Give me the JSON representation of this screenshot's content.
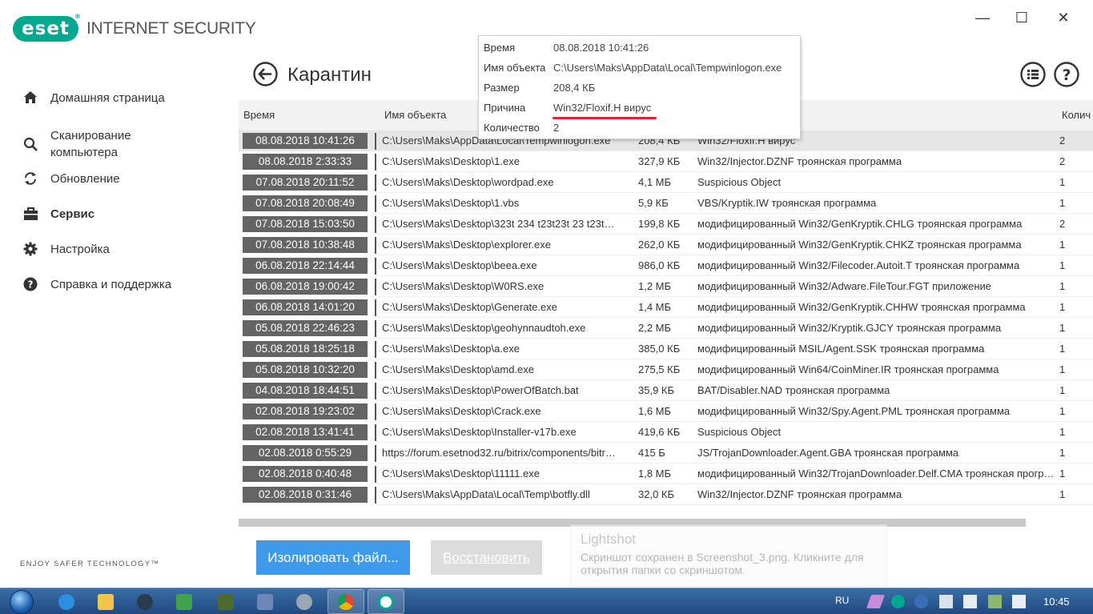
{
  "app": {
    "logo": "eset",
    "product": "INTERNET SECURITY",
    "tagline": "ENJOY SAFER TECHNOLOGY™",
    "colors": {
      "brand": "#00a88f",
      "accent": "#3d9be9",
      "time_cell": "#646464",
      "highlight": "#e0262a"
    }
  },
  "window_controls": {
    "minimize": "—",
    "maximize": "☐",
    "close": "✕"
  },
  "sidebar": {
    "items": [
      {
        "label": "Домашняя страница",
        "icon": "home-icon"
      },
      {
        "label": "Сканирование\nкомпьютера",
        "icon": "search-icon"
      },
      {
        "label": "Обновление",
        "icon": "refresh-icon"
      },
      {
        "label": "Сервис",
        "icon": "briefcase-icon",
        "active": true
      },
      {
        "label": "Настройка",
        "icon": "gear-icon"
      },
      {
        "label": "Справка и поддержка",
        "icon": "question-icon"
      }
    ]
  },
  "page": {
    "title": "Карантин"
  },
  "table": {
    "columns": {
      "time": "Время",
      "name": "Имя объекта",
      "count": "Колич"
    },
    "rows": [
      {
        "time": "08.08.2018 10:41:26",
        "name": "C:\\Users\\Maks\\AppData\\Local\\Tempwinlogon.exe",
        "size": "208,4 КБ",
        "reason": "Win32/Floxif.H вирус",
        "count": "2"
      },
      {
        "time": "08.08.2018 2:33:33",
        "name": "C:\\Users\\Maks\\Desktop\\1.exe",
        "size": "327,9 КБ",
        "reason": "Win32/Injector.DZNF троянская программа",
        "count": "2"
      },
      {
        "time": "07.08.2018 20:11:52",
        "name": "C:\\Users\\Maks\\Desktop\\wordpad.exe",
        "size": "4,1 МБ",
        "reason": "Suspicious Object",
        "count": "1"
      },
      {
        "time": "07.08.2018 20:08:49",
        "name": "C:\\Users\\Maks\\Desktop\\1.vbs",
        "size": "5,9 КБ",
        "reason": "VBS/Kryptik.IW троянская программа",
        "count": "1"
      },
      {
        "time": "07.08.2018 15:03:50",
        "name": "C:\\Users\\Maks\\Desktop\\323t 234 t23t23t 23 t23t…",
        "size": "199,8 КБ",
        "reason": "модифицированный Win32/GenKryptik.CHLG троянская программа",
        "count": "2"
      },
      {
        "time": "07.08.2018 10:38:48",
        "name": "C:\\Users\\Maks\\Desktop\\explorer.exe",
        "size": "262,0 КБ",
        "reason": "модифицированный Win32/GenKryptik.CHKZ троянская программа",
        "count": "1"
      },
      {
        "time": "06.08.2018 22:14:44",
        "name": "C:\\Users\\Maks\\Desktop\\beea.exe",
        "size": "986,0 КБ",
        "reason": "модифицированный Win32/Filecoder.Autoit.T троянская программа",
        "count": "1"
      },
      {
        "time": "06.08.2018 19:00:42",
        "name": "C:\\Users\\Maks\\Desktop\\W0RS.exe",
        "size": "1,2 МБ",
        "reason": "модифицированный Win32/Adware.FileTour.FGT приложение",
        "count": "1"
      },
      {
        "time": "06.08.2018 14:01:20",
        "name": "C:\\Users\\Maks\\Desktop\\Generate.exe",
        "size": "1,4 МБ",
        "reason": "модифицированный Win32/GenKryptik.CHHW троянская программа",
        "count": "1"
      },
      {
        "time": "05.08.2018 22:46:23",
        "name": "C:\\Users\\Maks\\Desktop\\geohynnaudtoh.exe",
        "size": "2,2 МБ",
        "reason": "модифицированный Win32/Kryptik.GJCY троянская программа",
        "count": "1"
      },
      {
        "time": "05.08.2018 18:25:18",
        "name": "C:\\Users\\Maks\\Desktop\\a.exe",
        "size": "385,0 КБ",
        "reason": "модифицированный MSIL/Agent.SSK троянская программа",
        "count": "1"
      },
      {
        "time": "05.08.2018 10:32:20",
        "name": "C:\\Users\\Maks\\Desktop\\amd.exe",
        "size": "275,5 КБ",
        "reason": "модифицированный Win64/CoinMiner.IR троянская программа",
        "count": "1"
      },
      {
        "time": "04.08.2018 18:44:51",
        "name": "C:\\Users\\Maks\\Desktop\\PowerOfBatch.bat",
        "size": "35,9 КБ",
        "reason": "BAT/Disabler.NAD троянская программа",
        "count": "1"
      },
      {
        "time": "02.08.2018 19:23:02",
        "name": "C:\\Users\\Maks\\Desktop\\Crack.exe",
        "size": "1,6 МБ",
        "reason": "модифицированный Win32/Spy.Agent.PML троянская программа",
        "count": "1"
      },
      {
        "time": "02.08.2018 13:41:41",
        "name": "C:\\Users\\Maks\\Desktop\\Installer-v17b.exe",
        "size": "419,6 КБ",
        "reason": "Suspicious Object",
        "count": "1"
      },
      {
        "time": "02.08.2018 0:55:29",
        "name": "https://forum.esetnod32.ru/bitrix/components/bitr…",
        "size": "415 Б",
        "reason": "JS/TrojanDownloader.Agent.GBA троянская программа",
        "count": "1"
      },
      {
        "time": "02.08.2018 0:40:48",
        "name": "C:\\Users\\Maks\\Desktop\\11111.exe",
        "size": "1,8 МБ",
        "reason": "модифицированный Win32/TrojanDownloader.Delf.CMA троянская программа",
        "count": "1"
      },
      {
        "time": "02.08.2018 0:31:46",
        "name": "C:\\Users\\Maks\\AppData\\Local\\Temp\\botfly.dll",
        "size": "32,0 КБ",
        "reason": "Win32/Injector.DZNF троянская программа",
        "count": "1"
      }
    ]
  },
  "tooltip": {
    "rows": [
      {
        "key": "Время",
        "value": "08.08.2018 10:41:26"
      },
      {
        "key": "Имя объекта",
        "value": "C:\\Users\\Maks\\AppData\\Local\\Tempwinlogon.exe"
      },
      {
        "key": "Размер",
        "value": "208,4 КБ"
      },
      {
        "key": "Причина",
        "value": "Win32/Floxif.H вирус"
      },
      {
        "key": "Количество",
        "value": "2"
      }
    ]
  },
  "buttons": {
    "quarantine": "Изолировать файл...",
    "restore": "Восстановить"
  },
  "notification": {
    "title": "Lightshot",
    "text": "Скриншот сохранен в Screenshot_3.png. Кликните для открытия папки со скриншотом."
  },
  "taskbar": {
    "lang": "RU",
    "clock": "10:45",
    "apps": [
      "ie-icon",
      "explorer-icon",
      "media-icon",
      "network-tool-icon",
      "cmd-icon",
      "monitor-icon",
      "settings-icon",
      "chrome-icon",
      "eset-icon"
    ]
  }
}
